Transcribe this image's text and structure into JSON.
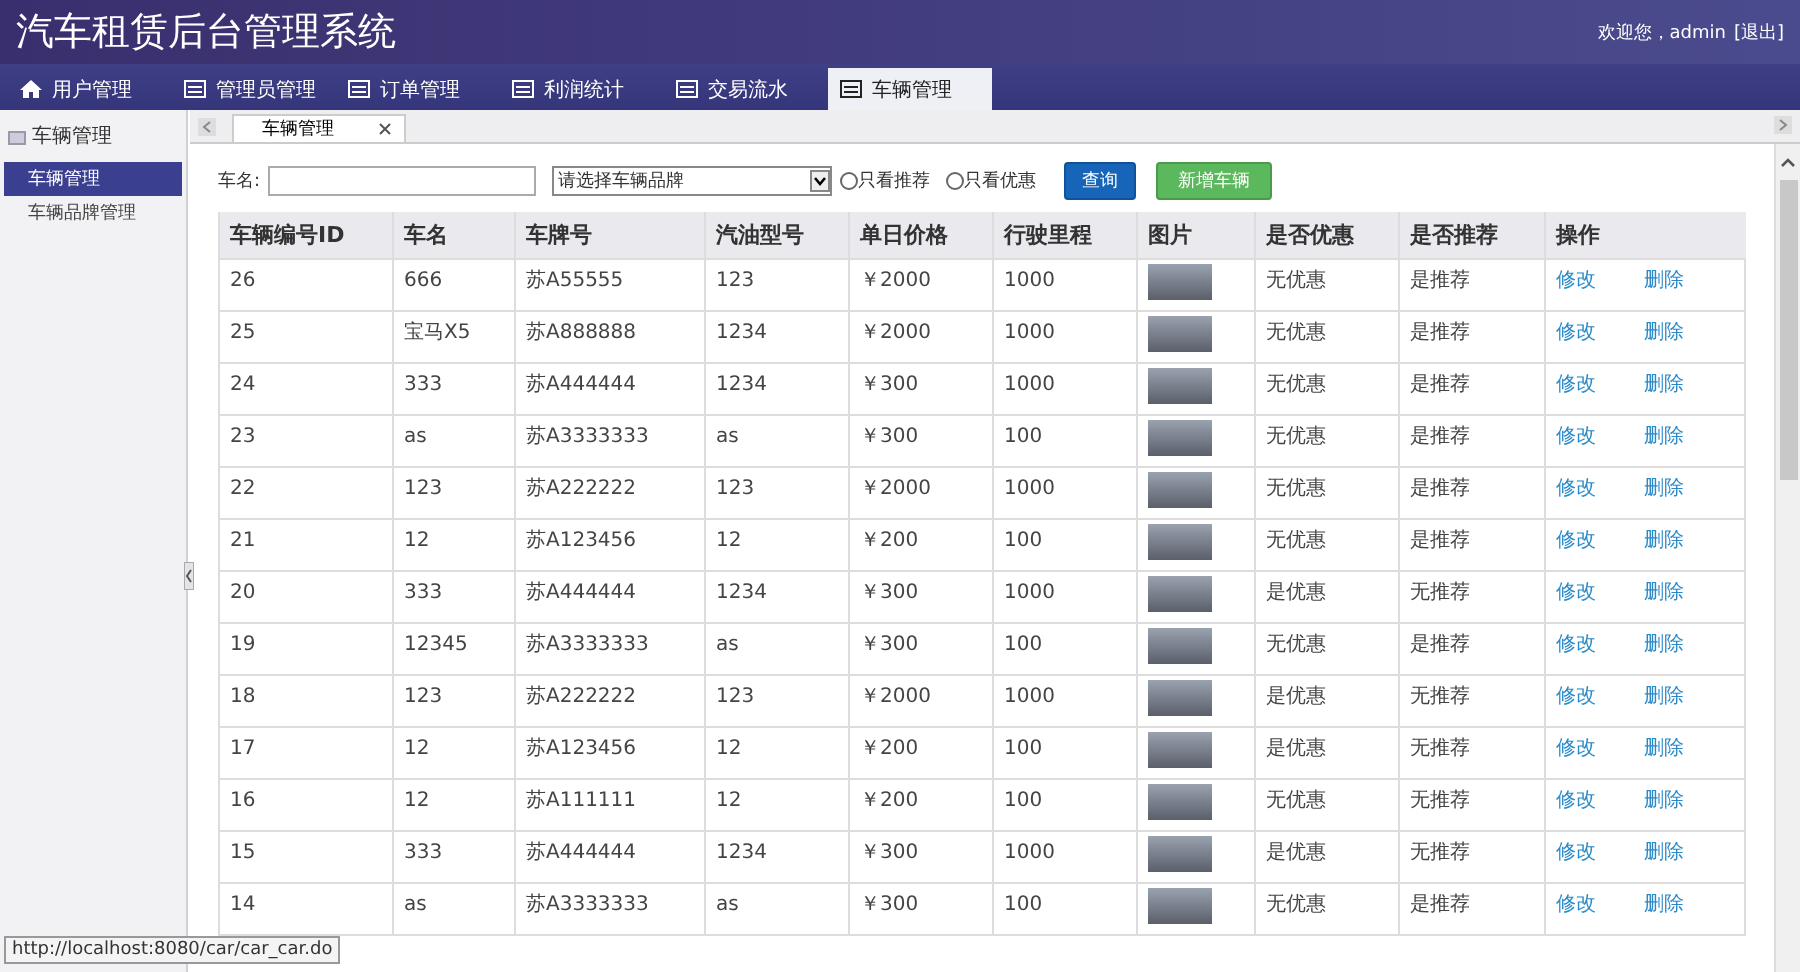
{
  "header": {
    "title": "汽车租赁后台管理系统",
    "welcome": "欢迎您，admin",
    "logout": "[退出]"
  },
  "nav_tabs": [
    {
      "label": "用户管理",
      "kind": "home",
      "selected": false
    },
    {
      "label": "管理员管理",
      "kind": "form",
      "selected": false
    },
    {
      "label": "订单管理",
      "kind": "form",
      "selected": false
    },
    {
      "label": "利润统计",
      "kind": "form",
      "selected": false
    },
    {
      "label": "交易流水",
      "kind": "form",
      "selected": false
    },
    {
      "label": "车辆管理",
      "kind": "form",
      "selected": true
    }
  ],
  "sidebar": {
    "title": "车辆管理",
    "items": [
      {
        "label": "车辆管理",
        "selected": true
      },
      {
        "label": "车辆品牌管理",
        "selected": false
      }
    ]
  },
  "content_tabs": [
    {
      "label": "车辆管理",
      "selected": true
    }
  ],
  "filter": {
    "name_label": "车名:",
    "brand_select": "请选择车辆品牌",
    "recommend_only": {
      "label": "只看推荐",
      "checked": false
    },
    "discount_only": {
      "label": "只看优惠",
      "checked": false
    },
    "query_button": "查询",
    "add_button": "新增车辆"
  },
  "table": {
    "columns": [
      "车辆编号ID",
      "车名",
      "车牌号",
      "汽油型号",
      "单日价格",
      "行驶里程",
      "图片",
      "是否优惠",
      "是否推荐",
      "操作"
    ],
    "rows": [
      {
        "id": "26",
        "name": "666",
        "plate": "苏A55555",
        "fuel": "123",
        "price": "￥2000",
        "mileage": "1000",
        "discount": "无优惠",
        "recommend": "是推荐",
        "edit": "修改",
        "delete": "删除"
      },
      {
        "id": "25",
        "name": "宝马X5",
        "plate": "苏A888888",
        "fuel": "1234",
        "price": "￥2000",
        "mileage": "1000",
        "discount": "无优惠",
        "recommend": "是推荐",
        "edit": "修改",
        "delete": "删除"
      },
      {
        "id": "24",
        "name": "333",
        "plate": "苏A444444",
        "fuel": "1234",
        "price": "￥300",
        "mileage": "1000",
        "discount": "无优惠",
        "recommend": "是推荐",
        "edit": "修改",
        "delete": "删除"
      },
      {
        "id": "23",
        "name": "as",
        "plate": "苏A3333333",
        "fuel": "as",
        "price": "￥300",
        "mileage": "100",
        "discount": "无优惠",
        "recommend": "是推荐",
        "edit": "修改",
        "delete": "删除"
      },
      {
        "id": "22",
        "name": "123",
        "plate": "苏A222222",
        "fuel": "123",
        "price": "￥2000",
        "mileage": "1000",
        "discount": "无优惠",
        "recommend": "是推荐",
        "edit": "修改",
        "delete": "删除"
      },
      {
        "id": "21",
        "name": "12",
        "plate": "苏A123456",
        "fuel": "12",
        "price": "￥200",
        "mileage": "100",
        "discount": "无优惠",
        "recommend": "是推荐",
        "edit": "修改",
        "delete": "删除"
      },
      {
        "id": "20",
        "name": "333",
        "plate": "苏A444444",
        "fuel": "1234",
        "price": "￥300",
        "mileage": "1000",
        "discount": "是优惠",
        "recommend": "无推荐",
        "edit": "修改",
        "delete": "删除"
      },
      {
        "id": "19",
        "name": "12345",
        "plate": "苏A3333333",
        "fuel": "as",
        "price": "￥300",
        "mileage": "100",
        "discount": "无优惠",
        "recommend": "是推荐",
        "edit": "修改",
        "delete": "删除"
      },
      {
        "id": "18",
        "name": "123",
        "plate": "苏A222222",
        "fuel": "123",
        "price": "￥2000",
        "mileage": "1000",
        "discount": "是优惠",
        "recommend": "无推荐",
        "edit": "修改",
        "delete": "删除"
      },
      {
        "id": "17",
        "name": "12",
        "plate": "苏A123456",
        "fuel": "12",
        "price": "￥200",
        "mileage": "100",
        "discount": "是优惠",
        "recommend": "无推荐",
        "edit": "修改",
        "delete": "删除"
      },
      {
        "id": "16",
        "name": "12",
        "plate": "苏A111111",
        "fuel": "12",
        "price": "￥200",
        "mileage": "100",
        "discount": "无优惠",
        "recommend": "无推荐",
        "edit": "修改",
        "delete": "删除"
      },
      {
        "id": "15",
        "name": "333",
        "plate": "苏A444444",
        "fuel": "1234",
        "price": "￥300",
        "mileage": "1000",
        "discount": "是优惠",
        "recommend": "无推荐",
        "edit": "修改",
        "delete": "删除"
      },
      {
        "id": "14",
        "name": "as",
        "plate": "苏A3333333",
        "fuel": "as",
        "price": "￥300",
        "mileage": "100",
        "discount": "无优惠",
        "recommend": "是推荐",
        "edit": "修改",
        "delete": "删除"
      }
    ]
  },
  "status_url": "http://localhost:8080/car/car_car.do"
}
